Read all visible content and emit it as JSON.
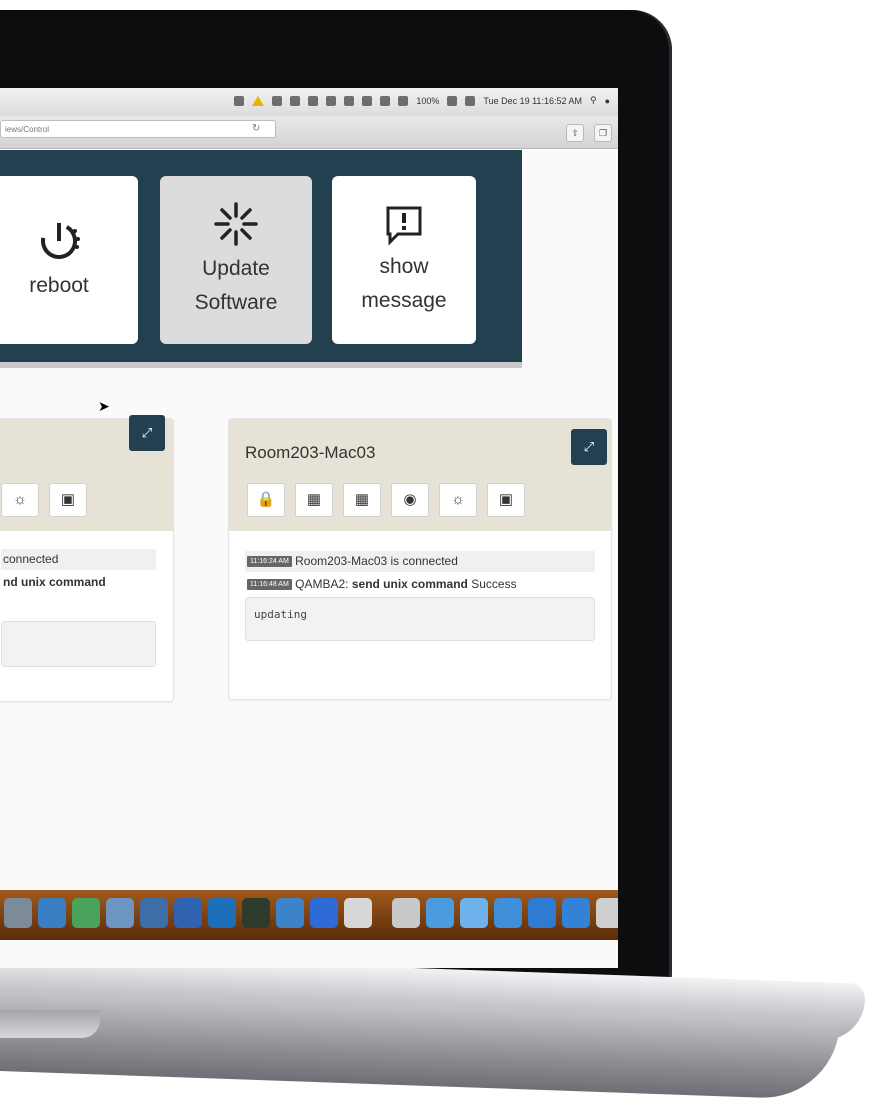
{
  "menubar": {
    "battery": "100%",
    "datetime": "Tue Dec 19  11:16:52 AM"
  },
  "browser": {
    "url": "iews/Control"
  },
  "actions": [
    {
      "label_line1": "reboot",
      "label_line2": "",
      "icon": "power-icon"
    },
    {
      "label_line1": "Update",
      "label_line2": "Software",
      "icon": "loading-spinner-icon"
    },
    {
      "label_line1": "show",
      "label_line2": "message",
      "icon": "message-icon"
    }
  ],
  "left_card": {
    "log": [
      {
        "text": "connected"
      },
      {
        "bold": "nd unix command"
      }
    ]
  },
  "right_card": {
    "title": "Room203-Mac03",
    "log": [
      {
        "timestamp": "11:16:24 AM",
        "text": "Room203-Mac03 is connected"
      },
      {
        "timestamp": "11:16:48 AM",
        "source": "QAMBA2:",
        "bold": "send unix command",
        "result": "Success"
      }
    ],
    "output": "updating"
  },
  "colors": {
    "panel": "#22404f",
    "card_header": "#e6e2d6"
  }
}
